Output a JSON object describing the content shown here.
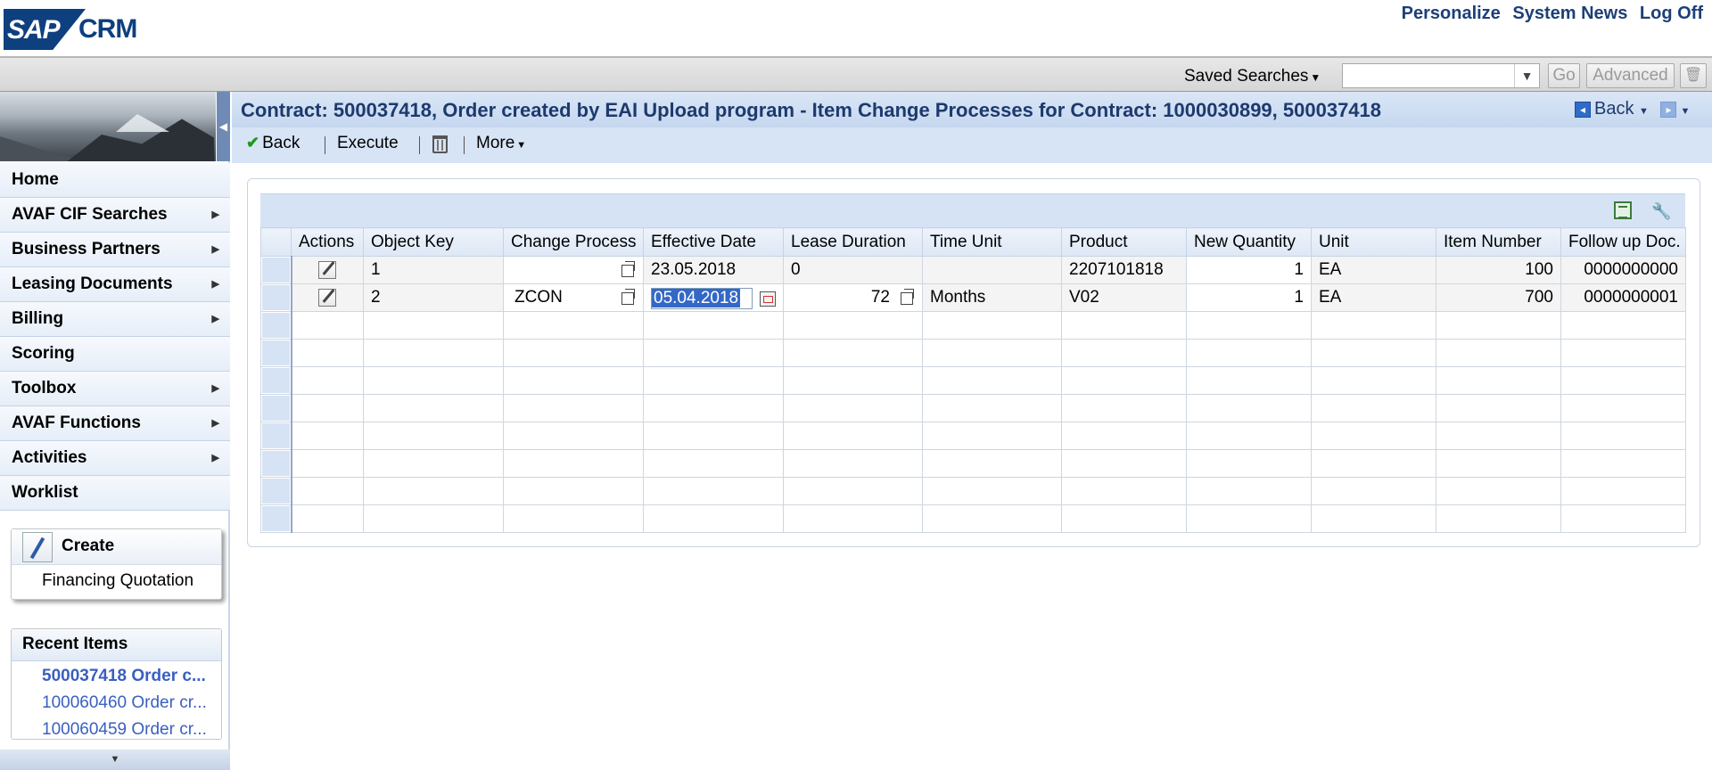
{
  "header": {
    "logo_sap": "SAP",
    "logo_crm": "CRM",
    "links": [
      "Personalize",
      "System News",
      "Log Off"
    ]
  },
  "searchbar": {
    "saved_searches_label": "Saved Searches",
    "input_value": "",
    "go_label": "Go",
    "advanced_label": "Advanced"
  },
  "sidebar": {
    "nav_items": [
      {
        "label": "Home",
        "has_submenu": false
      },
      {
        "label": "AVAF CIF Searches",
        "has_submenu": true
      },
      {
        "label": "Business Partners",
        "has_submenu": true
      },
      {
        "label": "Leasing Documents",
        "has_submenu": true
      },
      {
        "label": "Billing",
        "has_submenu": true
      },
      {
        "label": "Scoring",
        "has_submenu": false
      },
      {
        "label": "Toolbox",
        "has_submenu": true
      },
      {
        "label": "AVAF Functions",
        "has_submenu": true
      },
      {
        "label": "Activities",
        "has_submenu": true
      },
      {
        "label": "Worklist",
        "has_submenu": false
      }
    ],
    "create": {
      "title": "Create",
      "items": [
        "Financing Quotation"
      ]
    },
    "recent": {
      "title": "Recent Items",
      "items": [
        {
          "label": "500037418 Order c...",
          "bold": true
        },
        {
          "label": "100060460 Order cr...",
          "bold": false
        },
        {
          "label": "100060459 Order cr...",
          "bold": false
        }
      ]
    }
  },
  "main": {
    "title": "Contract: 500037418, Order created by EAI Upload program - Item Change Processes for Contract: 1000030899, 500037418",
    "back_label": "Back",
    "toolbar": {
      "back_label": "Back",
      "execute_label": "Execute",
      "more_label": "More"
    },
    "table": {
      "columns": [
        "Actions",
        "Object Key",
        "Change Process",
        "Effective Date",
        "Lease Duration",
        "Time Unit",
        "Product",
        "New Quantity",
        "Unit",
        "Item Number",
        "Follow up Doc."
      ],
      "rows": [
        {
          "object_key": "1",
          "change_process": "",
          "effective_date": "23.05.2018",
          "lease_duration": "0",
          "time_unit": "",
          "product": "2207101818",
          "new_quantity": "1",
          "unit": "EA",
          "item_number": "100",
          "follow_up_doc": "0000000000"
        },
        {
          "object_key": "2",
          "change_process": "ZCON",
          "effective_date": "05.04.2018",
          "lease_duration": "72",
          "time_unit": "Months",
          "product": "V02",
          "new_quantity": "1",
          "unit": "EA",
          "item_number": "700",
          "follow_up_doc": "0000000001"
        }
      ],
      "empty_rows": 8
    }
  },
  "colors": {
    "brand_blue": "#0e3f7e",
    "title_text": "#1d3a6e",
    "link_blue": "#3a5fc0",
    "toolbar_bg": "#d7e4f6"
  }
}
